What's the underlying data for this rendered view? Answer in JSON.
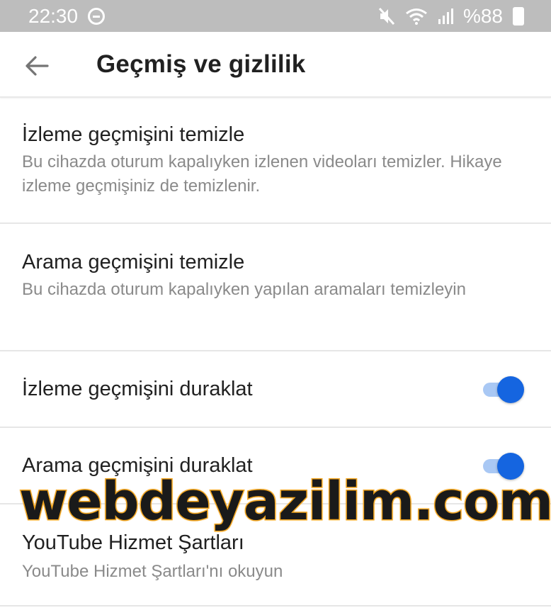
{
  "status_bar": {
    "time": "22:30",
    "battery": "%88"
  },
  "app_bar": {
    "title": "Geçmiş ve gizlilik"
  },
  "settings": {
    "clear_watch_history": {
      "title": "İzleme geçmişini temizle",
      "subtitle": "Bu cihazda oturum kapalıyken izlenen videoları temizler. Hikaye izleme geçmişiniz de temizlenir."
    },
    "clear_search_history": {
      "title": "Arama geçmişini temizle",
      "subtitle": "Bu cihazda oturum kapalıyken yapılan aramaları temizleyin"
    },
    "pause_watch_history": {
      "title": "İzleme geçmişini duraklat",
      "enabled": true
    },
    "pause_search_history": {
      "title": "Arama geçmişini duraklat",
      "enabled": true
    },
    "terms_of_service": {
      "title": "YouTube Hizmet Şartları",
      "subtitle": "YouTube Hizmet Şartları'nı okuyun"
    }
  },
  "watermark": {
    "text": "webdeyazilim.com"
  },
  "colors": {
    "status_bar_bg": "#bdbdbd",
    "toggle_on": "#1565e0",
    "toggle_track": "#a9c8f4",
    "watermark_outline": "#f2a51f"
  }
}
